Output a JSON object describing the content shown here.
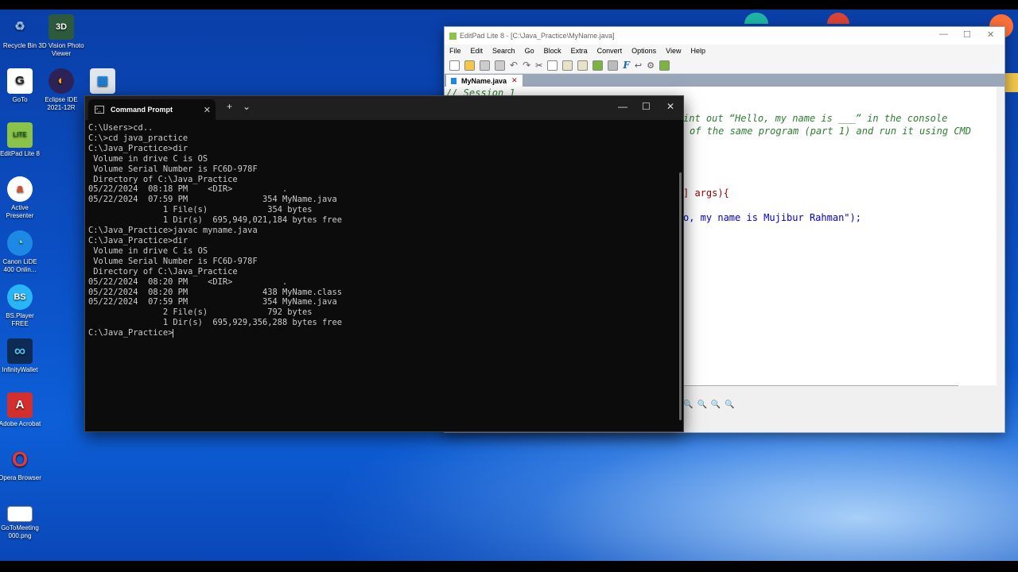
{
  "desktop_icons": [
    {
      "label": "Recycle Bin",
      "glyph": "♻",
      "color": "#8fb8e8"
    },
    {
      "label": "3D Vision Photo Viewer",
      "glyph": "3D",
      "color": "#2d5a3c"
    },
    {
      "label": "GoTo",
      "glyph": "G",
      "color": "#ffffff"
    },
    {
      "label": "Eclipse IDE 2021-12R",
      "glyph": "◐",
      "color": "#2c2255"
    },
    {
      "label": "EditPad Lite 8",
      "glyph": "LITE",
      "color": "#8bc34a"
    },
    {
      "label": "Active Presenter",
      "glyph": "a",
      "color": "#ffffff"
    },
    {
      "label": "Canon LiDE 400 Onlin...",
      "glyph": "◔",
      "color": "#1e88e5"
    },
    {
      "label": "BS.Player FREE",
      "glyph": "BS",
      "color": "#29b6f6"
    },
    {
      "label": "InfinityWallet",
      "glyph": "∞",
      "color": "#1565c0"
    },
    {
      "label": "Adobe Acrobat",
      "glyph": "A",
      "color": "#d32f2f"
    },
    {
      "label": "Opera Browser",
      "glyph": "O",
      "color": "#e53935"
    },
    {
      "label": "GoToMeeting 000.png",
      "glyph": "",
      "color": "#ffffff"
    }
  ],
  "editpad": {
    "title": "EditPad Lite 8 - [C:\\Java_Practice\\MyName.java]",
    "menu": [
      "File",
      "Edit",
      "Search",
      "Go",
      "Block",
      "Extra",
      "Convert",
      "Options",
      "View",
      "Help"
    ],
    "tab": "MyName.java",
    "code": [
      {
        "text": "// Session 1",
        "color": "#2e7d32",
        "italic": true
      },
      {
        "text": "int out “Hello, my name is ___” in the console",
        "color": "#2e7d32",
        "italic": true
      },
      {
        "text": "of the same program (part 1) and run it using CMD",
        "color": "#2e7d32",
        "italic": true
      },
      {
        "text": "] args){",
        "color": "#8b0000",
        "italic": false
      },
      {
        "text": "o, my name is Mujibur Rahman\");",
        "color": "#0000cc",
        "italic": false
      }
    ]
  },
  "terminal": {
    "tab_title": "Command Prompt",
    "new_tab": "+",
    "dropdown": "⌄",
    "lines": [
      "C:\\Users>cd..",
      "",
      "C:\\>cd java_practice",
      "",
      "C:\\Java_Practice>dir",
      " Volume in drive C is OS",
      " Volume Serial Number is FC6D-978F",
      "",
      " Directory of C:\\Java_Practice",
      "",
      "05/22/2024  08:18 PM    <DIR>          .",
      "05/22/2024  07:59 PM               354 MyName.java",
      "               1 File(s)            354 bytes",
      "               1 Dir(s)  695,949,021,184 bytes free",
      "",
      "C:\\Java_Practice>javac myname.java",
      "",
      "C:\\Java_Practice>dir",
      " Volume in drive C is OS",
      " Volume Serial Number is FC6D-978F",
      "",
      " Directory of C:\\Java_Practice",
      "",
      "05/22/2024  08:20 PM    <DIR>          .",
      "05/22/2024  08:20 PM               438 MyName.class",
      "05/22/2024  07:59 PM               354 MyName.java",
      "               2 File(s)            792 bytes",
      "               1 Dir(s)  695,929,356,288 bytes free",
      "",
      "C:\\Java_Practice>"
    ]
  }
}
